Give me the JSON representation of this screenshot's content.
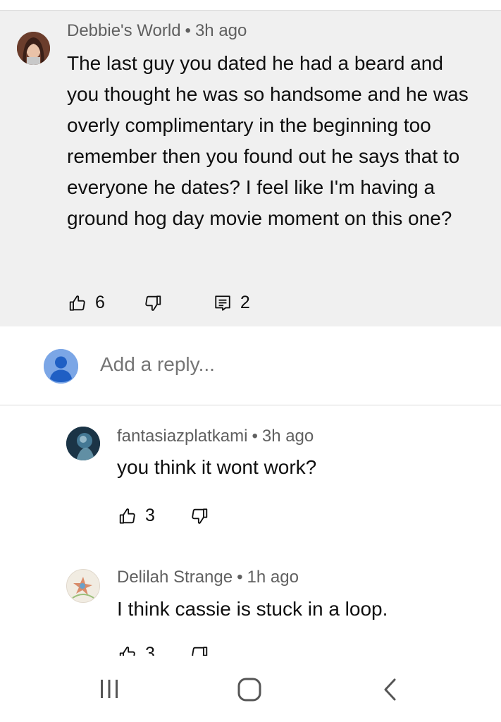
{
  "parent_comment": {
    "author": "Debbie's World",
    "separator": "•",
    "time": "3h ago",
    "text": "The last guy you dated he had a beard and you thought he was so handsome and he was overly complimentary in the beginning too remember then you found out he says that to everyone he dates? I feel like I'm having a ground hog day movie moment on this one?",
    "likes": "6",
    "replies_count": "2",
    "icons": {
      "like": "thumbs-up-icon",
      "dislike": "thumbs-down-icon",
      "replies": "comment-icon"
    }
  },
  "reply_box": {
    "placeholder": "Add a reply...",
    "avatar_color": "#7ba6e6"
  },
  "replies": [
    {
      "author": "fantasiazplatkami",
      "separator": "•",
      "time": "3h ago",
      "text": "you think it wont work?",
      "likes": "3"
    },
    {
      "author": "Delilah Strange",
      "separator": "•",
      "time": "1h ago",
      "text": "I think cassie is stuck in a loop.",
      "likes": "3"
    }
  ],
  "nav_bar": {
    "recents": "recents-icon",
    "home": "home-icon",
    "back": "back-icon"
  },
  "colors": {
    "highlight_bg": "#f0f0f0",
    "meta_text": "#606060",
    "primary_text": "#0f0f0f",
    "divider": "#d9d9d9"
  }
}
